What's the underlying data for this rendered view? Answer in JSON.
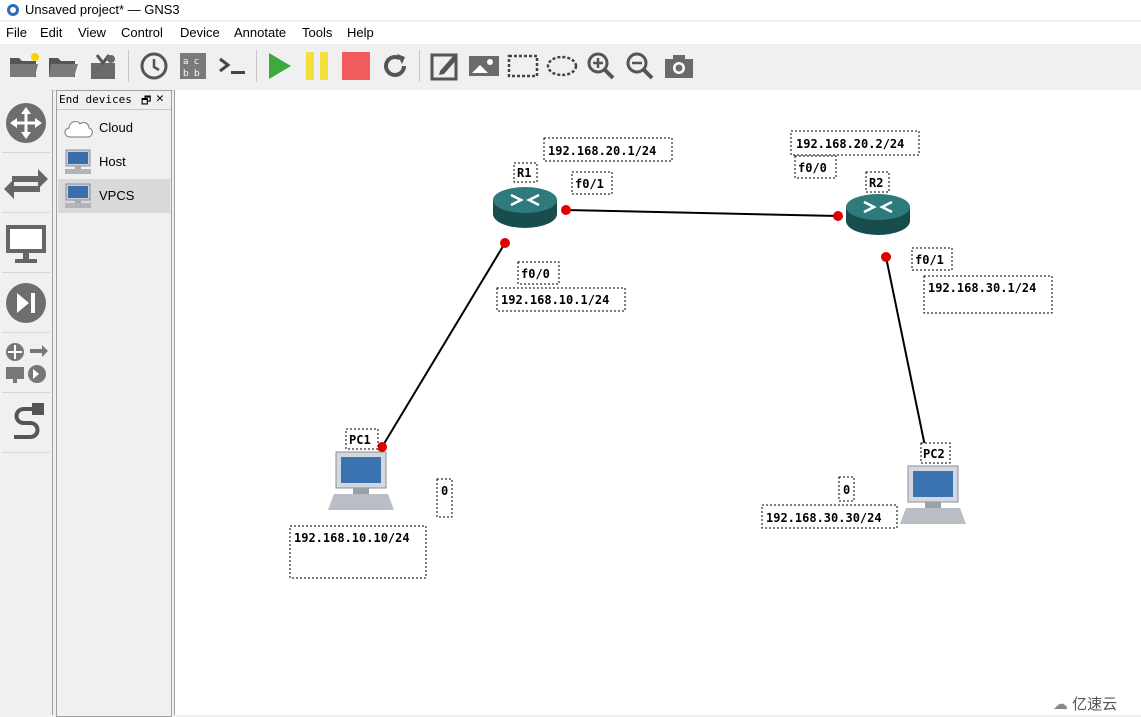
{
  "window": {
    "title": "Unsaved project* — GNS3"
  },
  "menu": [
    "File",
    "Edit",
    "View",
    "Control",
    "Device",
    "Annotate",
    "Tools",
    "Help"
  ],
  "toolbar": {
    "buttons": [
      "open-project-icon",
      "open-folder-icon",
      "save-snapshot-icon",
      "clock-icon",
      "show-labels-icon",
      "console-icon",
      "start-icon",
      "pause-icon",
      "stop-icon",
      "reload-icon",
      "add-note-icon",
      "insert-picture-icon",
      "draw-rectangle-icon",
      "draw-ellipse-icon",
      "zoom-in-icon",
      "zoom-out-icon",
      "screenshot-icon"
    ]
  },
  "leftbar": {
    "buttons": [
      "browse-routers",
      "browse-switches",
      "browse-end-devices",
      "browse-security-devices",
      "browse-all-devices",
      "add-link"
    ]
  },
  "dock": {
    "title": "End devices",
    "items": [
      {
        "label": "Cloud",
        "icon": "cloud-icon"
      },
      {
        "label": "Host",
        "icon": "host-icon"
      },
      {
        "label": "VPCS",
        "icon": "vpcs-icon",
        "selected": true
      }
    ]
  },
  "topology": {
    "nodes": {
      "r1": {
        "name": "R1"
      },
      "r2": {
        "name": "R2"
      },
      "pc1": {
        "name": "PC1"
      },
      "pc2": {
        "name": "PC2"
      }
    },
    "labels": {
      "r1_f01": "f0/1",
      "r1_f01_ip": "192.168.20.1/24",
      "r1_f00": "f0/0",
      "r1_f00_ip": "192.168.10.1/24",
      "r2_f00": "f0/0",
      "r2_f00_ip": "192.168.20.2/24",
      "r2_f01": "f0/1",
      "r2_f01_ip": "192.168.30.1/24",
      "pc1_port": "0",
      "pc1_ip": "192.168.10.10/24",
      "pc2_port": "0",
      "pc2_ip": "192.168.30.30/24"
    },
    "link_color": "#000000",
    "port_color": "#e00000",
    "router_color": "#1f5c5c"
  },
  "watermark": "亿速云"
}
